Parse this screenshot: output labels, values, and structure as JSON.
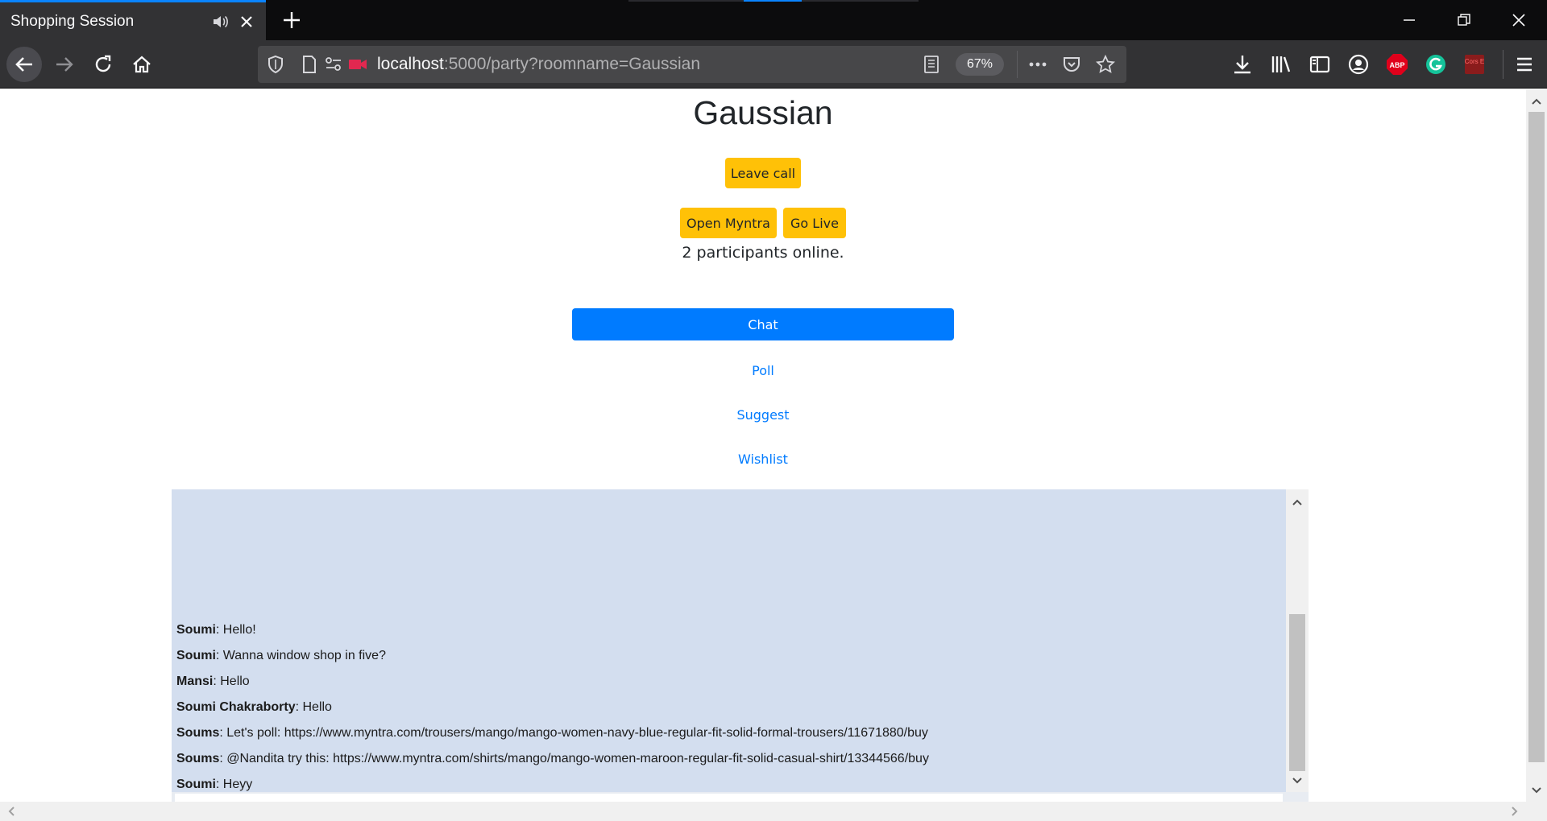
{
  "browser": {
    "tab_title": "Shopping Session",
    "url_host": "localhost",
    "url_rest": ":5000/party?roomname=Gaussian",
    "zoom": "67%",
    "abp_label": "ABP",
    "cors_label": "Cors E",
    "accent_color": "#0a84ff"
  },
  "page": {
    "room_name": "Gaussian",
    "leave_call_label": "Leave call",
    "open_myntra_label": "Open Myntra",
    "go_live_label": "Go Live",
    "participants_text": "2 participants online.",
    "tabs": [
      {
        "label": "Chat",
        "active": true
      },
      {
        "label": "Poll",
        "active": false
      },
      {
        "label": "Suggest",
        "active": false
      },
      {
        "label": "Wishlist",
        "active": false
      }
    ],
    "colors": {
      "button_warning": "#ffc107",
      "tab_active": "#007bff",
      "chat_background": "#d3deef"
    }
  },
  "chat": {
    "messages": [
      {
        "sender": "Soumi",
        "text": ": Hello!"
      },
      {
        "sender": "Soumi",
        "text": ": Wanna window shop in five?"
      },
      {
        "sender": "Mansi",
        "text": ": Hello"
      },
      {
        "sender": "Soumi Chakraborty",
        "text": ": Hello"
      },
      {
        "sender": "Soums",
        "text": ": Let's poll: https://www.myntra.com/trousers/mango/mango-women-navy-blue-regular-fit-solid-formal-trousers/11671880/buy"
      },
      {
        "sender": "Soums",
        "text": ": @Nandita try this: https://www.myntra.com/shirts/mango/mango-women-maroon-regular-fit-solid-casual-shirt/13344566/buy"
      },
      {
        "sender": "Soumi",
        "text": ": Heyy"
      }
    ]
  }
}
